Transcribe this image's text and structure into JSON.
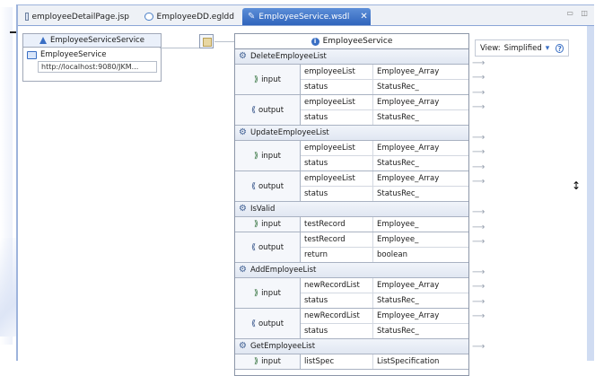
{
  "tabs": [
    {
      "label": "employeeDetailPage.jsp",
      "active": false,
      "icon": "jsp-file-icon"
    },
    {
      "label": "EmployeeDD.egldd",
      "active": false,
      "icon": "deployment-descriptor-icon"
    },
    {
      "label": "EmployeeService.wsdl",
      "active": true,
      "icon": "wsdl-file-icon",
      "close": "✕"
    }
  ],
  "service": {
    "title": "EmployeeServiceService",
    "port": "EmployeeService",
    "address": "http://localhost:9080/JKM..."
  },
  "interface": {
    "title": "EmployeeService",
    "operations": [
      {
        "name": "DeleteEmployeeList",
        "input": [
          {
            "name": "employeeList",
            "type": "Employee_Array"
          },
          {
            "name": "status",
            "type": "StatusRec_"
          }
        ],
        "output": [
          {
            "name": "employeeList",
            "type": "Employee_Array"
          },
          {
            "name": "status",
            "type": "StatusRec_"
          }
        ]
      },
      {
        "name": "UpdateEmployeeList",
        "input": [
          {
            "name": "employeeList",
            "type": "Employee_Array"
          },
          {
            "name": "status",
            "type": "StatusRec_"
          }
        ],
        "output": [
          {
            "name": "employeeList",
            "type": "Employee_Array"
          },
          {
            "name": "status",
            "type": "StatusRec_"
          }
        ]
      },
      {
        "name": "IsValid",
        "input": [
          {
            "name": "testRecord",
            "type": "Employee_"
          }
        ],
        "output": [
          {
            "name": "testRecord",
            "type": "Employee_"
          },
          {
            "name": "return",
            "type": "boolean"
          }
        ]
      },
      {
        "name": "AddEmployeeList",
        "input": [
          {
            "name": "newRecordList",
            "type": "Employee_Array"
          },
          {
            "name": "status",
            "type": "StatusRec_"
          }
        ],
        "output": [
          {
            "name": "newRecordList",
            "type": "Employee_Array"
          },
          {
            "name": "status",
            "type": "StatusRec_"
          }
        ]
      },
      {
        "name": "GetEmployeeList",
        "input": [
          {
            "name": "listSpec",
            "type": "ListSpecification"
          }
        ],
        "output": []
      }
    ]
  },
  "labels": {
    "input": "input",
    "output": "output"
  },
  "view": {
    "label": "View:",
    "value": "Simplified"
  },
  "colors": {
    "accent": "#3a6fc4",
    "tab_active": "#2f64bc"
  }
}
